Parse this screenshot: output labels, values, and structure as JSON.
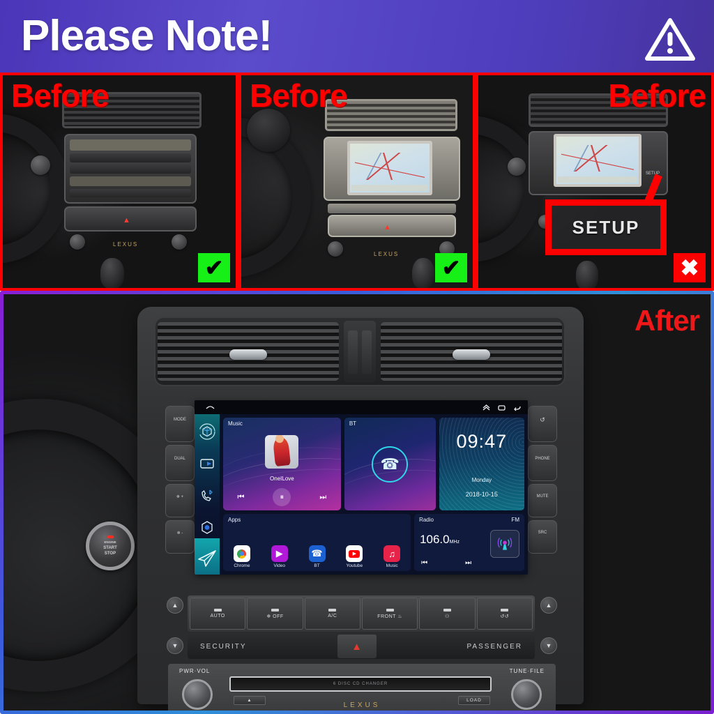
{
  "header": {
    "title": "Please Note!",
    "icon": "warning-triangle-icon",
    "bg_start": "#4b35b8",
    "bg_end": "#46339f"
  },
  "comparison": {
    "before_label": "Before",
    "after_label": "After",
    "ok_mark": "✔",
    "no_mark": "✖",
    "panels": [
      {
        "label": "Before",
        "verdict": "compatible",
        "badge": "✔",
        "badge_color": "#16f016",
        "description": "Lexus IS dash with CD/audio head unit, no navigation screen"
      },
      {
        "label": "Before",
        "verdict": "compatible",
        "badge": "✔",
        "badge_color": "#16f016",
        "description": "Lexus IS beige dash with factory navigation map screen"
      },
      {
        "label": "Before",
        "verdict": "not-compatible",
        "badge": "✖",
        "badge_color": "#fe0000",
        "description": "Lexus IS dark dash with navigation and SETUP button",
        "callout": "SETUP"
      }
    ]
  },
  "after_panel": {
    "label": "After",
    "start_button": {
      "line1": "ENGINE",
      "line2": "START",
      "line3": "STOP"
    },
    "left_buttons": [
      "MODE",
      "DUAL",
      "❄ +",
      "❄ -"
    ],
    "right_buttons": [
      "↺",
      "PHONE",
      "MUTE",
      "SRC"
    ],
    "climate_buttons": [
      {
        "label": "AUTO"
      },
      {
        "label": "❄ OFF"
      },
      {
        "label": "A/C"
      },
      {
        "label": "FRONT ♨"
      },
      {
        "label": "⚇"
      },
      {
        "label": "↺↺"
      }
    ],
    "security_label": "SECURITY",
    "passenger_label": "PASSENGER",
    "hazard_icon": "hazard-triangle-icon",
    "cd_panel": {
      "left_label": "PWR·VOL",
      "right_label": "TUNE·FILE",
      "slot_text": "6 DISC CD CHANGER",
      "eject_label": "▲",
      "load_label": "LOAD",
      "brand": "LEXUS"
    }
  },
  "head_unit": {
    "status_bar": {
      "home_icon": "home-icon",
      "right_icons": [
        "chevron-up-icon",
        "recents-icon",
        "back-icon"
      ]
    },
    "sidebar": [
      {
        "name": "apps-cube-icon",
        "label": ""
      },
      {
        "name": "screen-mirror-icon",
        "label": ""
      },
      {
        "name": "phone-bt-icon",
        "label": ""
      },
      {
        "name": "settings-hex-icon",
        "label": ""
      },
      {
        "name": "navigation-plane-icon",
        "label": ""
      }
    ],
    "music_card": {
      "title": "Music",
      "track": "OneILove",
      "prev": "⏮",
      "play": "⏸",
      "next": "⏭"
    },
    "bt_card": {
      "title": "BT",
      "icon": "bluetooth-phone-icon"
    },
    "clock_card": {
      "time": "09:47",
      "weekday": "Monday",
      "date": "2018-10-15"
    },
    "apps_card": {
      "title": "Apps",
      "apps": [
        {
          "name": "Chrome",
          "icon": "chrome-icon"
        },
        {
          "name": "Video",
          "icon": "video-icon"
        },
        {
          "name": "BT",
          "icon": "bluetooth-icon"
        },
        {
          "name": "Youtube",
          "icon": "youtube-icon"
        },
        {
          "name": "Music",
          "icon": "music-headphones-icon"
        }
      ]
    },
    "radio_card": {
      "title": "Radio",
      "band": "FM",
      "frequency": "106.0",
      "unit": "MHz",
      "prev": "⏮",
      "next": "⏭",
      "antenna_icon": "broadcast-antenna-icon"
    }
  }
}
